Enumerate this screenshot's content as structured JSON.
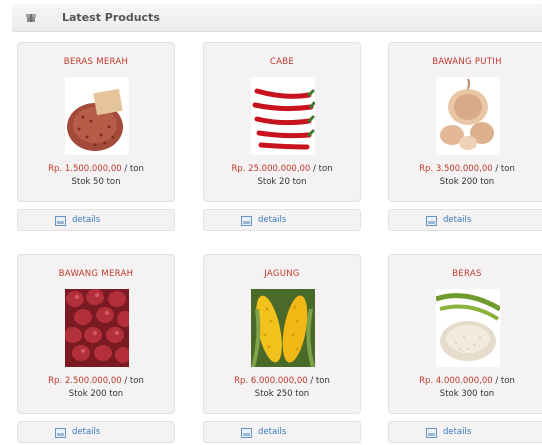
{
  "header": {
    "title": "Latest Products",
    "icon": "box-icon"
  },
  "products": [
    {
      "name": "BERAS MERAH",
      "price": "Rp. 1.500.000,00",
      "unit": " / ton",
      "stock": "Stok 50 ton",
      "details_label": "details"
    },
    {
      "name": "CABE",
      "price": "Rp. 25.000.000,00",
      "unit": " / ton",
      "stock": "Stok 20 ton",
      "details_label": "details"
    },
    {
      "name": "BAWANG PUTIH",
      "price": "Rp. 3.500.000,00",
      "unit": " / ton",
      "stock": "Stok 200 ton",
      "details_label": "details"
    },
    {
      "name": "BAWANG MERAH",
      "price": "Rp. 2.500.000,00",
      "unit": " / ton",
      "stock": "Stok 200 ton",
      "details_label": "details"
    },
    {
      "name": "JAGUNG",
      "price": "Rp. 6.000.000,00",
      "unit": " / ton",
      "stock": "Stok 250 ton",
      "details_label": "details"
    },
    {
      "name": "BERAS",
      "price": "Rp. 4.000.000,00",
      "unit": " / ton",
      "stock": "Stok 300 ton",
      "details_label": "details"
    }
  ],
  "colors": {
    "accent_red": "#c0392b",
    "link_blue": "#3a7bbf",
    "card_bg": "#f4f2f2"
  }
}
